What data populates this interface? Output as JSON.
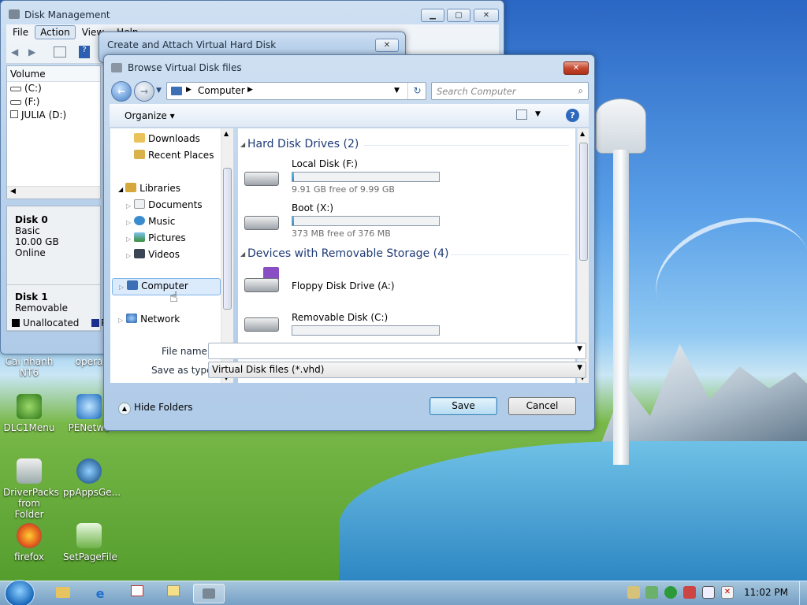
{
  "disk_management": {
    "title": "Disk Management",
    "menus": [
      "File",
      "Action",
      "View",
      "Help"
    ],
    "volume_header": "Volume",
    "volumes": [
      "(C:)",
      "(F:)",
      "JULIA (D:)"
    ],
    "disks": [
      {
        "name": "Disk 0",
        "lines": [
          "Basic",
          "10.00 GB",
          "Online"
        ]
      },
      {
        "name": "Disk 1",
        "lines": [
          "Removable"
        ]
      }
    ],
    "legend": "Unallocated",
    "legend2": "P"
  },
  "create_attach": {
    "title": "Create and Attach Virtual Hard Disk"
  },
  "browse": {
    "title": "Browse Virtual Disk files",
    "address": "Computer",
    "search_placeholder": "Search Computer",
    "organize": "Organize",
    "nav": {
      "downloads": "Downloads",
      "recent": "Recent Places",
      "libraries": "Libraries",
      "documents": "Documents",
      "music": "Music",
      "pictures": "Pictures",
      "videos": "Videos",
      "computer": "Computer",
      "network": "Network"
    },
    "groups": {
      "hdd": "Hard Disk Drives (2)",
      "removable": "Devices with Removable Storage (4)"
    },
    "drives": [
      {
        "name": "Local Disk (F:)",
        "free": "9.91 GB free of 9.99 GB",
        "used_fraction": 0.01
      },
      {
        "name": "Boot (X:)",
        "free": "373 MB free of 376 MB",
        "used_fraction": 0.01
      }
    ],
    "removable": [
      {
        "name": "Floppy Disk Drive (A:)"
      },
      {
        "name": "Removable Disk (C:)"
      }
    ],
    "file_name_label": "File name:",
    "file_name_value": "",
    "save_type_label": "Save as type:",
    "save_type_value": "Virtual Disk files (*.vhd)",
    "hide_folders": "Hide Folders",
    "save": "Save",
    "cancel": "Cancel"
  },
  "desktop": {
    "icons": [
      {
        "label": "Cai nhanh NT6"
      },
      {
        "label": "opera"
      },
      {
        "label": "DLC1Menu"
      },
      {
        "label": "PENetwo"
      },
      {
        "label": "DriverPacks from Folder"
      },
      {
        "label": "ppAppsGe..."
      },
      {
        "label": "firefox"
      },
      {
        "label": "SetPageFile"
      }
    ]
  },
  "taskbar": {
    "clock": "11:02 PM"
  }
}
